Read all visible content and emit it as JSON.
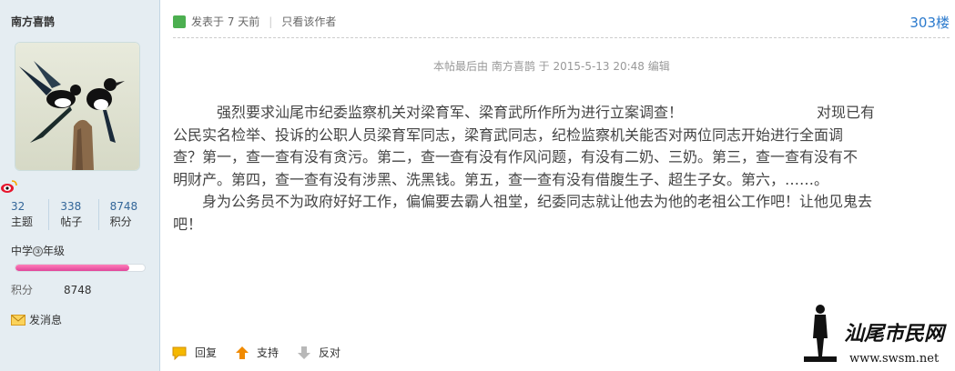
{
  "sidebar": {
    "username": "南方喜鹊",
    "stats": [
      {
        "value": "32",
        "label": "主题"
      },
      {
        "value": "338",
        "label": "帖子"
      },
      {
        "value": "8748",
        "label": "积分"
      }
    ],
    "level_prefix": "中学",
    "level_num": "③",
    "level_suffix": "年级",
    "level_progress": 0.88,
    "score_label": "积分",
    "score_value": "8748",
    "message_label": "发消息"
  },
  "post": {
    "posted_label": "发表于",
    "posted_time": "7 天前",
    "author_only": "只看该作者",
    "floor": "303楼",
    "edited_note": "本帖最后由 南方喜鹊 于 2015-5-13 20:48 编辑",
    "line1": "强烈要求汕尾市纪委监察机关对梁育军、梁育武所作所为进行立案调查！",
    "line1b": "对现已有",
    "line2": "公民实名检举、投诉的公职人员梁育军同志，梁育武同志，纪检监察机关能否对两位同志开始进行全面调",
    "line3": "查？第一，查一查有没有贪污。第二，查一查有没有作风问题，有没有二奶、三奶。第三，查一查有没有不",
    "line4": "明财产。第四，查一查有没有涉黑、洗黑钱。第五，查一查有没有借腹生子、超生子女。第六，……。",
    "line5": "身为公务员不为政府好好工作，偏偏要去霸人祖堂，纪委同志就让他去为他的老祖公工作吧！让他见鬼去",
    "line6": "吧！"
  },
  "actions": {
    "reply": "回复",
    "support": "支持",
    "oppose": "反对"
  },
  "watermark": {
    "text": "汕尾市民网",
    "url": "www.swsm.net"
  },
  "colors": {
    "sidebar_bg": "#e5edf2",
    "floor_blue": "#2b7acd",
    "level_bar": "#e0449a"
  }
}
